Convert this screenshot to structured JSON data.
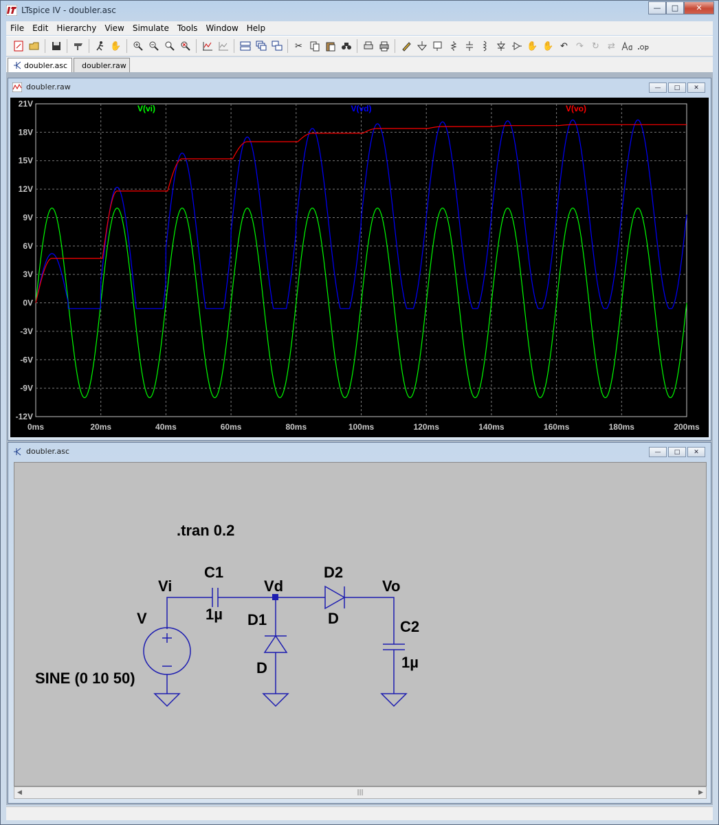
{
  "app": {
    "title": "LTspice IV - doubler.asc"
  },
  "menu": [
    "File",
    "Edit",
    "Hierarchy",
    "View",
    "Simulate",
    "Tools",
    "Window",
    "Help"
  ],
  "tabs": [
    {
      "label": "doubler.asc"
    },
    {
      "label": "doubler.raw"
    }
  ],
  "waveform_window": {
    "title": "doubler.raw"
  },
  "schematic_window": {
    "title": "doubler.asc"
  },
  "chart_data": {
    "type": "line",
    "xlabel": "",
    "ylabel": "",
    "xlim": [
      0,
      200
    ],
    "ylim": [
      -12,
      21
    ],
    "x_ticks": [
      "0ms",
      "20ms",
      "40ms",
      "60ms",
      "80ms",
      "100ms",
      "120ms",
      "140ms",
      "160ms",
      "180ms",
      "200ms"
    ],
    "y_ticks": [
      "21V",
      "18V",
      "15V",
      "12V",
      "9V",
      "6V",
      "3V",
      "0V",
      "-3V",
      "-6V",
      "-9V",
      "-12V"
    ],
    "grid": true,
    "series": [
      {
        "name": "V(vi)",
        "color": "#00ff00",
        "shape": "sine",
        "amplitude": 10,
        "freq_hz": 50
      },
      {
        "name": "V(vd)",
        "color": "#0000ff",
        "shape": "clamped",
        "peaks": [
          5.2,
          12.2,
          15.8,
          17.5,
          18.4,
          18.9,
          19.1,
          19.2,
          19.3,
          19.3
        ],
        "floor": -0.6
      },
      {
        "name": "V(vo)",
        "color": "#ff0000",
        "shape": "staircase",
        "levels": [
          4.7,
          11.8,
          15.2,
          17.0,
          17.9,
          18.4,
          18.6,
          18.7,
          18.8,
          18.8
        ]
      }
    ]
  },
  "schematic": {
    "directive": ".tran 0.2",
    "source_name": "V",
    "source_value": "SINE (0 10 50)",
    "nets": {
      "vi": "Vi",
      "vd": "Vd",
      "vo": "Vo"
    },
    "c1": {
      "name": "C1",
      "value": "1µ"
    },
    "c2": {
      "name": "C2",
      "value": "1µ"
    },
    "d1": {
      "name": "D1",
      "model": "D"
    },
    "d2": {
      "name": "D2",
      "model": "D"
    },
    "wire_color": "#1c1cb0"
  }
}
